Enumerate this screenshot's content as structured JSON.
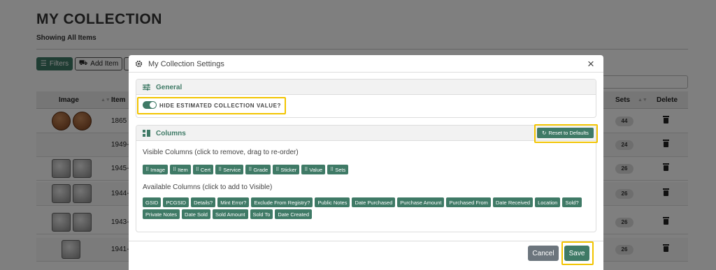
{
  "page": {
    "title": "MY COLLECTION",
    "subtitle": "Showing All Items",
    "filters_label": "Filters",
    "add_item_label": "Add Item",
    "table_headers": {
      "image": "Image",
      "item": "Item",
      "sets": "Sets",
      "delete": "Delete"
    },
    "rows": [
      {
        "item": "1865",
        "sets": "44"
      },
      {
        "item": "1949-",
        "sets": "24"
      },
      {
        "item": "1945-",
        "sets": "26"
      },
      {
        "item": "1944-",
        "sets": "26"
      },
      {
        "item": "1943-",
        "sets": "26"
      },
      {
        "item": "1941-",
        "sets": "26"
      }
    ]
  },
  "modal": {
    "title": "My Collection Settings",
    "general": {
      "title": "General",
      "toggle_label": "HIDE ESTIMATED COLLECTION VALUE?",
      "toggle_on": true
    },
    "columns": {
      "title": "Columns",
      "reset_label": "Reset to Defaults",
      "visible_label": "Visible Columns (click to remove, drag to re-order)",
      "visible": [
        "Image",
        "Item",
        "Cert",
        "Service",
        "Grade",
        "Sticker",
        "Value",
        "Sets"
      ],
      "available_label": "Available Columns (click to add to Visible)",
      "available": [
        "GSID",
        "PCGSID",
        "Details?",
        "Mint Error?",
        "Exclude From Registry?",
        "Public Notes",
        "Date Purchased",
        "Purchase Amount",
        "Purchased From",
        "Date Received",
        "Location",
        "Sold?",
        "Private Notes",
        "Date Sold",
        "Sold Amount",
        "Sold To",
        "Date Created"
      ]
    },
    "cancel_label": "Cancel",
    "save_label": "Save"
  },
  "colors": {
    "accent": "#3f7a66",
    "highlight": "#f2c400",
    "cancel": "#6c757d"
  },
  "icons": [
    "filter-icon",
    "car-icon",
    "gear-icon",
    "close-icon",
    "sliders-icon",
    "columns-icon",
    "refresh-icon",
    "grip-icon",
    "trash-icon"
  ]
}
